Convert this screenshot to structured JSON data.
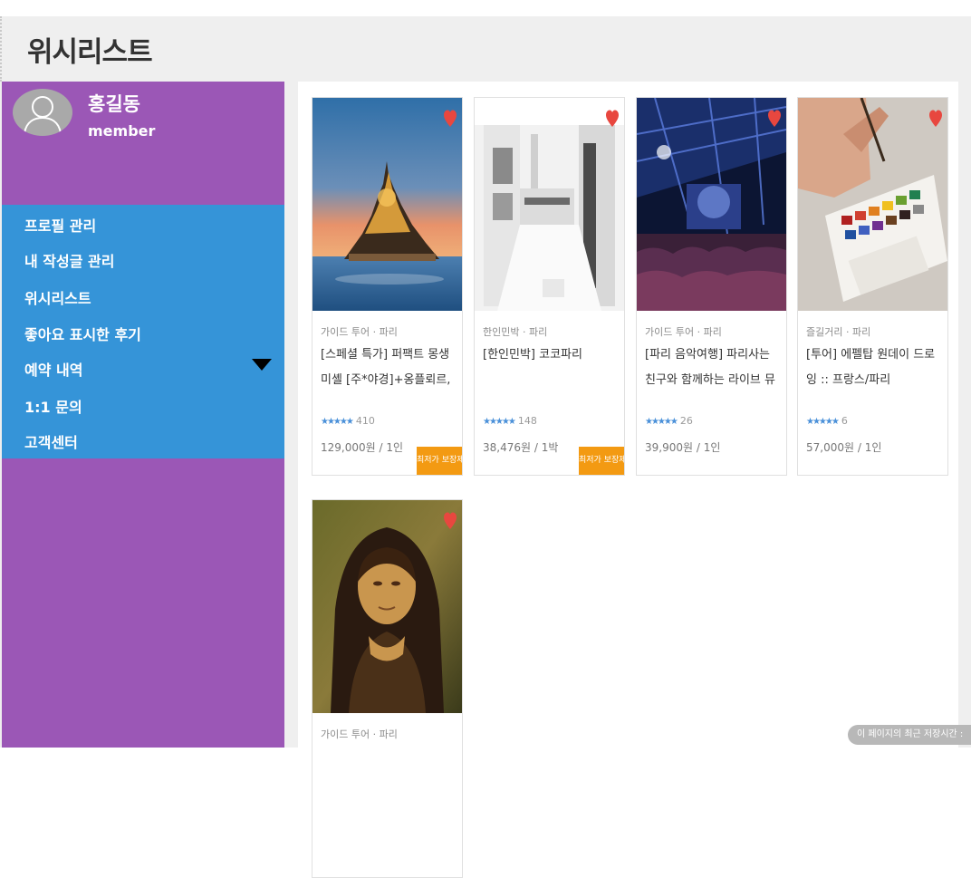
{
  "page": {
    "title": "위시리스트"
  },
  "profile": {
    "name": "홍길동",
    "role": "member"
  },
  "sidebar": {
    "menu": [
      {
        "label": "프로필 관리"
      },
      {
        "label": "내 작성글 관리"
      },
      {
        "label": "위시리스트"
      },
      {
        "label": "좋아요 표시한 후기"
      },
      {
        "label": "예약 내역"
      },
      {
        "label": "1:1 문의"
      },
      {
        "label": "고객센터"
      }
    ]
  },
  "wishlist": {
    "items": [
      {
        "category": "가이드 투어 · 파리",
        "title": "[스페셜 특가] 퍼팩트 몽생미셸 [주*야경]+옹플뢰르,에트르타 ...",
        "stars": "★★★★★",
        "reviews": "410",
        "price": "129,000원 / 1인",
        "badge": "최저가 보장제",
        "image": "mont-saint-michel"
      },
      {
        "category": "한인민박 · 파리",
        "title": "[한인민박] 코코파리",
        "stars": "★★★★★",
        "reviews": "148",
        "price": "38,476원 / 1박",
        "badge": "최저가 보장제",
        "image": "white-kitchen"
      },
      {
        "category": "가이드 투어 · 파리",
        "title": "[파리 음악여행] 파리사는 친구와 함께하는 라이브 뮤직 투어!",
        "stars": "★★★★★",
        "reviews": "26",
        "price": "39,900원 / 1인",
        "badge": "",
        "image": "concert"
      },
      {
        "category": "즐길거리 · 파리",
        "title": "[투어] 에펠탑 원데이 드로잉 :: 프랑스/파리",
        "stars": "★★★★★",
        "reviews": "6",
        "price": "57,000원 / 1인",
        "badge": "",
        "image": "watercolor"
      },
      {
        "category": "가이드 투어 · 파리",
        "title": "",
        "stars": "",
        "reviews": "",
        "price": "",
        "badge": "",
        "image": "mona-lisa"
      }
    ]
  },
  "footer": {
    "toast": "이 페이지의 최근 저장시간 :"
  },
  "colors": {
    "sidebar": "#9b57b6",
    "menu": "#3594d8",
    "badge": "#f39a12",
    "heart": "#e8473f",
    "stars": "#4a90d9"
  }
}
